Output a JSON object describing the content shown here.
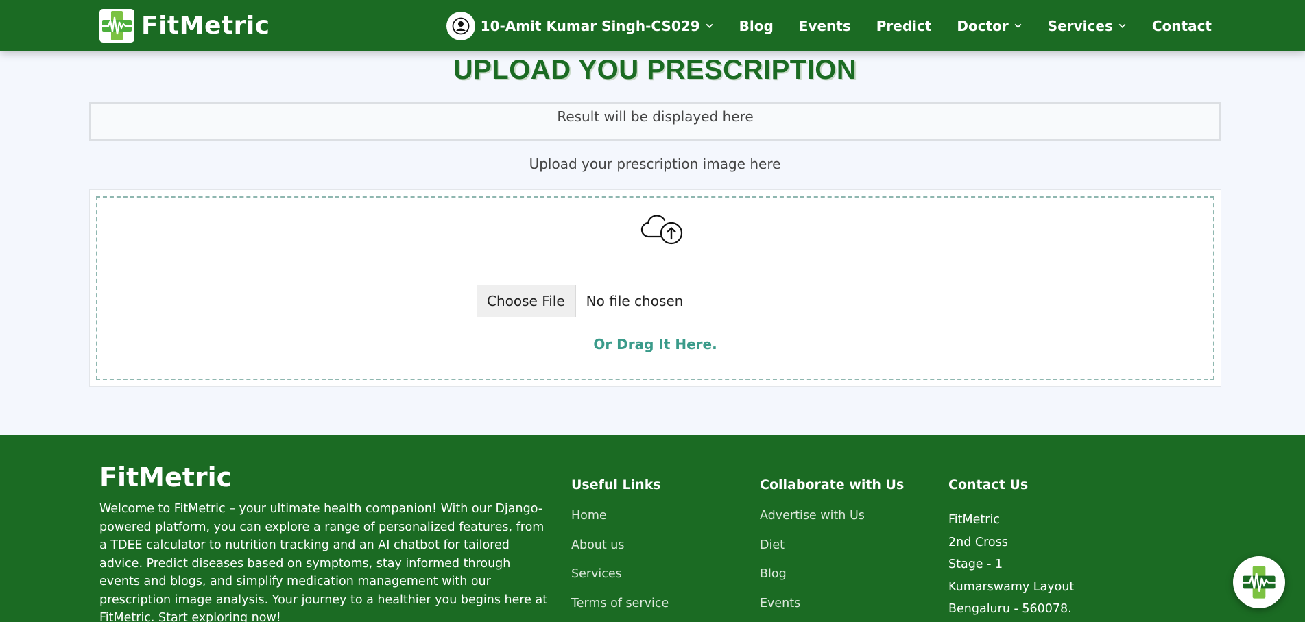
{
  "header": {
    "brand": "FitMetric",
    "user_name": "10-Amit Kumar Singh-CS029",
    "nav": {
      "blog": "Blog",
      "events": "Events",
      "predict": "Predict",
      "doctor": "Doctor",
      "services": "Services",
      "contact": "Contact"
    }
  },
  "main": {
    "title": "UPLOAD YOU PRESCRIPTION",
    "result_placeholder": "Result will be displayed here",
    "upload_label": "Upload your prescription image here",
    "choose_file_label": "Choose File",
    "file_status": "No file chosen",
    "drag_text": "Or Drag It Here."
  },
  "footer": {
    "brand": "FitMetric",
    "description": "Welcome to FitMetric – your ultimate health companion! With our Django-powered platform, you can explore a range of personalized features, from a TDEE calculator to nutrition tracking and an AI chatbot for tailored advice. Predict diseases based on symptoms, stay informed through events and blogs, and simplify medication management with our prescription image analysis. Your journey to a healthier you begins here at FitMetric. Start exploring now!",
    "useful_links": {
      "heading": "Useful Links",
      "items": [
        "Home",
        "About us",
        "Services",
        "Terms of service"
      ]
    },
    "collaborate": {
      "heading": "Collaborate with Us",
      "items": [
        "Advertise with Us",
        "Diet",
        "Blog",
        "Events"
      ]
    },
    "contact": {
      "heading": "Contact Us",
      "lines": [
        "FitMetric",
        "2nd Cross",
        "Stage - 1",
        "Kumarswamy Layout",
        "Bengaluru - 560078."
      ]
    }
  },
  "colors": {
    "brand_green": "#1b6b23",
    "accent_teal": "#3a9b8a",
    "logo_light_green": "#7cc242"
  },
  "icons": {
    "user": "user-circle-icon",
    "dropdown": "chevron-down-icon",
    "upload": "cloud-upload-icon",
    "chat": "chatbot-icon"
  }
}
